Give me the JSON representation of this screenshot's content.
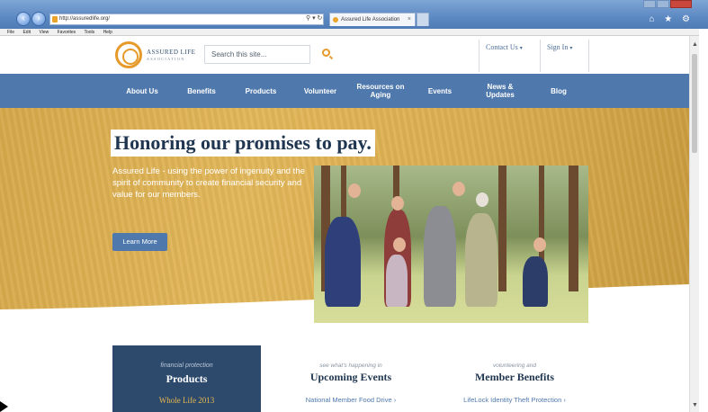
{
  "browser": {
    "address": "http://assuredlife.org/",
    "tab_title": "Assured Life Association",
    "tab_close": "×",
    "address_tools": "⚲ ▾ ↻",
    "menu": [
      "File",
      "Edit",
      "View",
      "Favorites",
      "Tools",
      "Help"
    ],
    "chrome_icons": "⌂ ★ ⚙"
  },
  "header": {
    "logo_name": "ASSURED LIFE",
    "logo_sub": "ASSOCIATION",
    "search_placeholder": "Search this site...",
    "contact": "Contact Us",
    "signin": "Sign In",
    "caret": "▾"
  },
  "nav": {
    "items": [
      "About Us",
      "Benefits",
      "Products",
      "Volunteer",
      "Resources on Aging",
      "Events",
      "News & Updates",
      "Blog"
    ]
  },
  "hero": {
    "headline": "Honoring our promises to pay.",
    "copy": "Assured Life - using the power of ingenuity and the spirit of community to create financial security and value for our members.",
    "button": "Learn More"
  },
  "products": {
    "kicker": "financial protection",
    "title": "Products",
    "link": "Whole Life 2013"
  },
  "events": {
    "kicker": "see what's happening in",
    "title": "Upcoming Events",
    "link": "National Member Food Drive ›"
  },
  "benefits": {
    "kicker": "volunteering and",
    "title": "Member Benefits",
    "link": "LifeLock Identity Theft Protection ›"
  },
  "scroll": {
    "up": "▲",
    "down": "▼"
  },
  "colors": {
    "nav": "#4f79ad",
    "gold": "#dcae4f",
    "navy": "#1f3550",
    "accent": "#e69a2a"
  }
}
